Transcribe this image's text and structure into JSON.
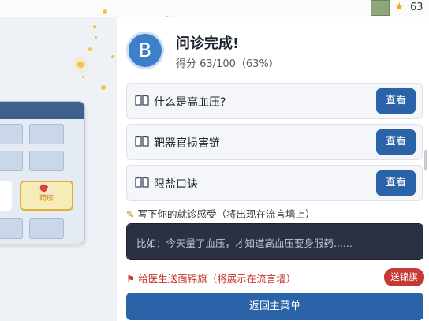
{
  "hud": {
    "score": "63",
    "icons": [
      "star-icon"
    ]
  },
  "background": {
    "pharmacy_label": "药房"
  },
  "result": {
    "avatar_letter": "B",
    "title": "问诊完成!",
    "score_text": "得分 63/100（63%）"
  },
  "knowledge_cards": [
    {
      "label": "什么是高血压?",
      "button": "查看",
      "icon": "book-icon"
    },
    {
      "label": "靶器官损害链",
      "button": "查看",
      "icon": "book-icon"
    },
    {
      "label": "限盐口诀",
      "button": "查看",
      "icon": "book-icon"
    }
  ],
  "feedback": {
    "label": "写下你的就诊感受（将出现在流言墙上）",
    "icon": "pencil-icon",
    "placeholder": "比如：今天量了血压，才知道高血压要身服药......"
  },
  "banner": {
    "label": "给医生送面锦旗（将展示在流言墙）",
    "icon": "flag-icon",
    "button": "送锦旗"
  },
  "return_button": "返回主菜单",
  "colors": {
    "primary": "#2a63a8",
    "danger": "#c63a33",
    "input_bg": "#2b3140",
    "avatar": "#3d7fc9"
  }
}
